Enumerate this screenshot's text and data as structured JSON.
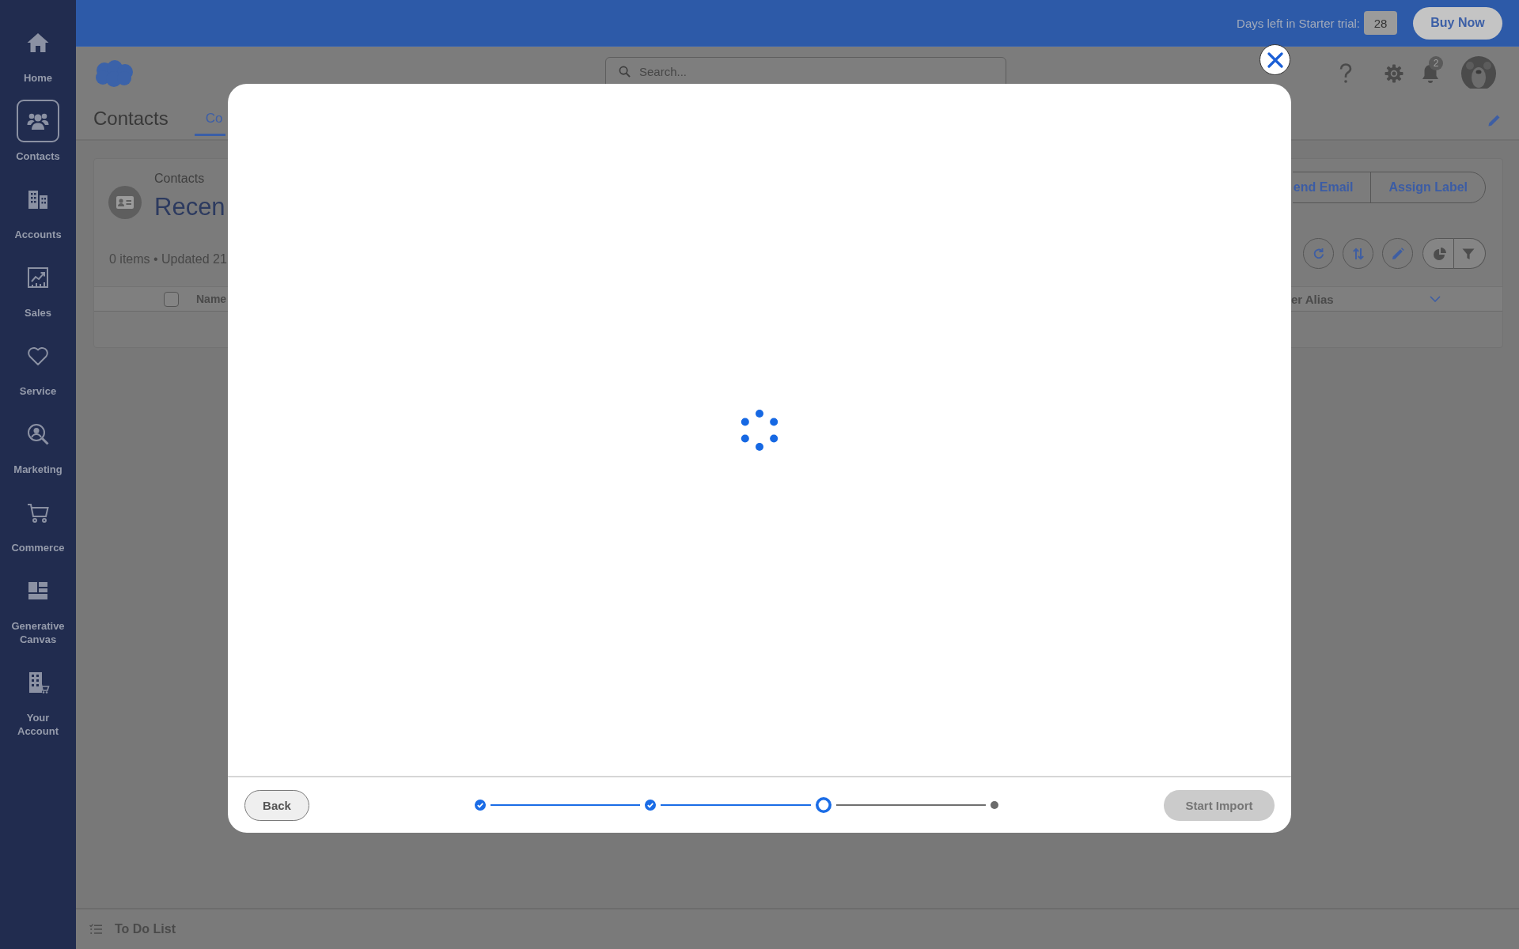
{
  "sidebar": {
    "items": [
      {
        "label": "Home",
        "selected": false
      },
      {
        "label": "Contacts",
        "selected": true
      },
      {
        "label": "Accounts",
        "selected": false
      },
      {
        "label": "Sales",
        "selected": false
      },
      {
        "label": "Service",
        "selected": false
      },
      {
        "label": "Marketing",
        "selected": false
      },
      {
        "label": "Commerce",
        "selected": false
      },
      {
        "label": "Generative Canvas",
        "selected": false
      },
      {
        "label": "Your Account",
        "selected": false
      }
    ]
  },
  "trial_bar": {
    "label": "Days left in Starter trial:",
    "days": "28",
    "buy_button": "Buy Now"
  },
  "header": {
    "search": {
      "placeholder": "Search..."
    },
    "notifications": {
      "count": "2"
    }
  },
  "nav": {
    "app_name": "Contacts",
    "tabs": [
      {
        "label": "Co",
        "selected": true
      }
    ]
  },
  "list_view": {
    "object_label": "Contacts",
    "title": "Recen",
    "summary": "0 items • Updated 21",
    "actions": [
      "end Email",
      "Assign Label"
    ],
    "select_all": {
      "checked": false
    },
    "columns": [
      {
        "label": "Name"
      },
      {
        "label": "er Alias"
      }
    ]
  },
  "modal": {
    "loading": true,
    "steps": [
      {
        "completed": true,
        "current": false
      },
      {
        "completed": true,
        "current": false
      },
      {
        "completed": false,
        "current": true
      },
      {
        "completed": false,
        "current": false
      }
    ],
    "back_button": "Back",
    "start_button": {
      "label": "Start Import",
      "disabled": true
    }
  },
  "utility_bar": {
    "label": "To Do List"
  }
}
